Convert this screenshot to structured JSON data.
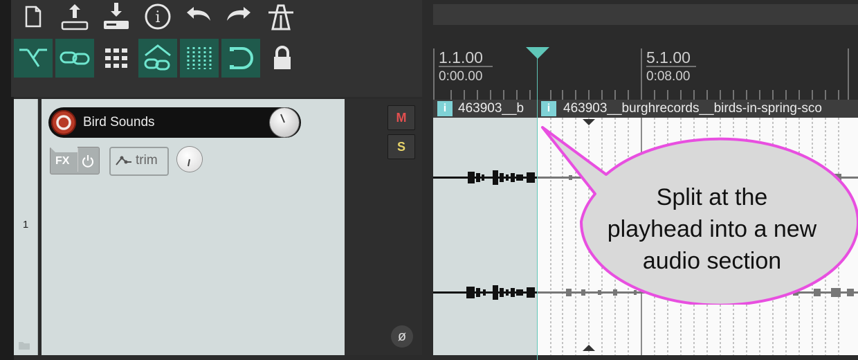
{
  "toolbar": {
    "row1_icons": [
      "new-project-icon",
      "open-project-icon",
      "save-project-icon",
      "info-icon",
      "undo-icon",
      "redo-icon",
      "metronome-icon"
    ],
    "row2_icons": [
      "ripple-edit-icon",
      "item-grouping-icon",
      "grid-icon",
      "envelope-link-icon",
      "snap-grid-icon",
      "loop-repeat-icon",
      "lock-icon"
    ]
  },
  "track": {
    "number": "1",
    "name": "Bird Sounds",
    "fx_label": "FX",
    "trim_label": "trim",
    "mute_label": "M",
    "solo_label": "S"
  },
  "ruler": {
    "marker1_bar": "1.1.00",
    "marker1_time": "0:00.00",
    "marker2_bar": "5.1.00",
    "marker2_time": "0:08.00"
  },
  "items": {
    "left_name": "463903__b",
    "right_name": "463903__burghrecords__birds-in-spring-sco"
  },
  "callout": {
    "line1": "Split at the",
    "line2": "playhead into a new",
    "line3": "audio section"
  },
  "colors": {
    "toolbar_active": "#1f5a4c",
    "accent": "#5fc6b8",
    "callout_border": "#e84fe0",
    "callout_fill": "#d9d9d9"
  }
}
